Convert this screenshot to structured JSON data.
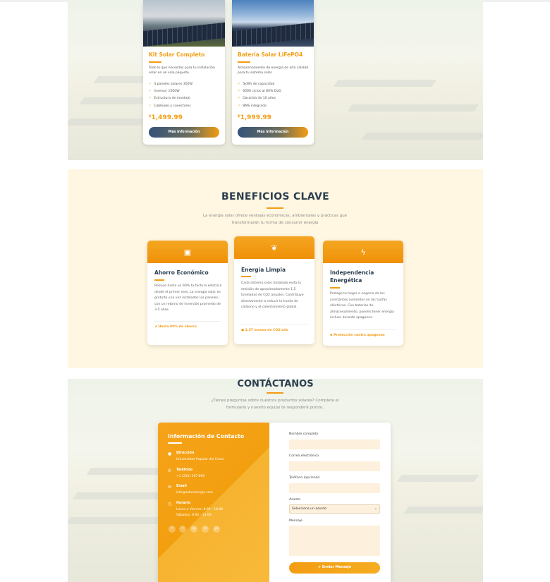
{
  "products": [
    {
      "title": "Kit Solar Completo",
      "description": "Todo lo que necesitas para tu instalación solar en un solo paquete.",
      "features": [
        "4 paneles solares 350W",
        "Inversor 1500W",
        "Estructura de montaje",
        "Cableado y conectores"
      ],
      "currency": "$",
      "price": "1,499.99",
      "button": "Más información"
    },
    {
      "title": "Batería Solar LiFePO4",
      "description": "Almacenamiento de energía de alta calidad para tu sistema solar.",
      "features": [
        "5kWh de capacidad",
        "6000 ciclos al 80% DoD",
        "Garantía de 10 años",
        "BMS integrado"
      ],
      "currency": "$",
      "price": "1,999.99",
      "button": "Más información"
    }
  ],
  "benefits": {
    "title": "BENEFICIOS CLAVE",
    "subtitle": "La energía solar ofrece ventajas económicas, ambientales y prácticas que transformarán tu forma de consumir energía",
    "cards": [
      {
        "icon": "money-icon",
        "title": "Ahorro Económico",
        "text": "Reduce hasta un 90% tu factura eléctrica desde el primer mes. La energía solar es gratuita una vez instalados los paneles, con un retorno de inversión promedio de 3-5 años.",
        "footer": "Hasta 90% de ahorro"
      },
      {
        "icon": "leaf-icon",
        "title": "Energía Limpia",
        "text": "Cada sistema solar instalado evita la emisión de aproximadamente 1.5 toneladas de CO2 anuales. Contribuye directamente a reducir la huella de carbono y el calentamiento global.",
        "footer": "1.5T menos de CO2/año"
      },
      {
        "icon": "bolt-icon",
        "title": "Independencia Energética",
        "text": "Protege tu hogar o negocio de los constantes aumentos en las tarifas eléctricas. Con baterías de almacenamiento, puedes tener energía incluso durante apagones.",
        "footer": "Protección contra apagones"
      }
    ]
  },
  "contact": {
    "title": "CONTÁCTANOS",
    "subtitle": "¿Tienes preguntas sobre nuestros productos solares? Completa el formulario y nuestro equipo te responderá pronto.",
    "info": {
      "title": "Información de Contacto",
      "items": [
        {
          "icon": "map-pin-icon",
          "label": "Dirección",
          "lines": [
            "Universidad Popular del Cesar"
          ]
        },
        {
          "icon": "phone-icon",
          "label": "Teléfono",
          "lines": [
            "+1 (234) 567-890"
          ]
        },
        {
          "icon": "envelope-icon",
          "label": "Email",
          "lines": [
            "info@solarenergia.com"
          ]
        },
        {
          "icon": "clock-icon",
          "label": "Horario",
          "lines": [
            "Lunes a Viernes: 8:00 - 18:00",
            "Sábados: 9:00 - 13:00"
          ]
        }
      ],
      "social": [
        "f",
        "t",
        "ig",
        "in",
        "yt"
      ]
    },
    "form": {
      "name_label": "Nombre completo",
      "email_label": "Correo electrónico",
      "phone_label": "Teléfono (opcional)",
      "subject_label": "Asunto",
      "subject_value": "Selecciona un asunto",
      "message_label": "Mensaje",
      "submit": "Enviar Mensaje"
    }
  },
  "colors": {
    "accent": "#f39c12",
    "heading": "#2c3e50",
    "benefits_bg": "#fff7e1"
  }
}
